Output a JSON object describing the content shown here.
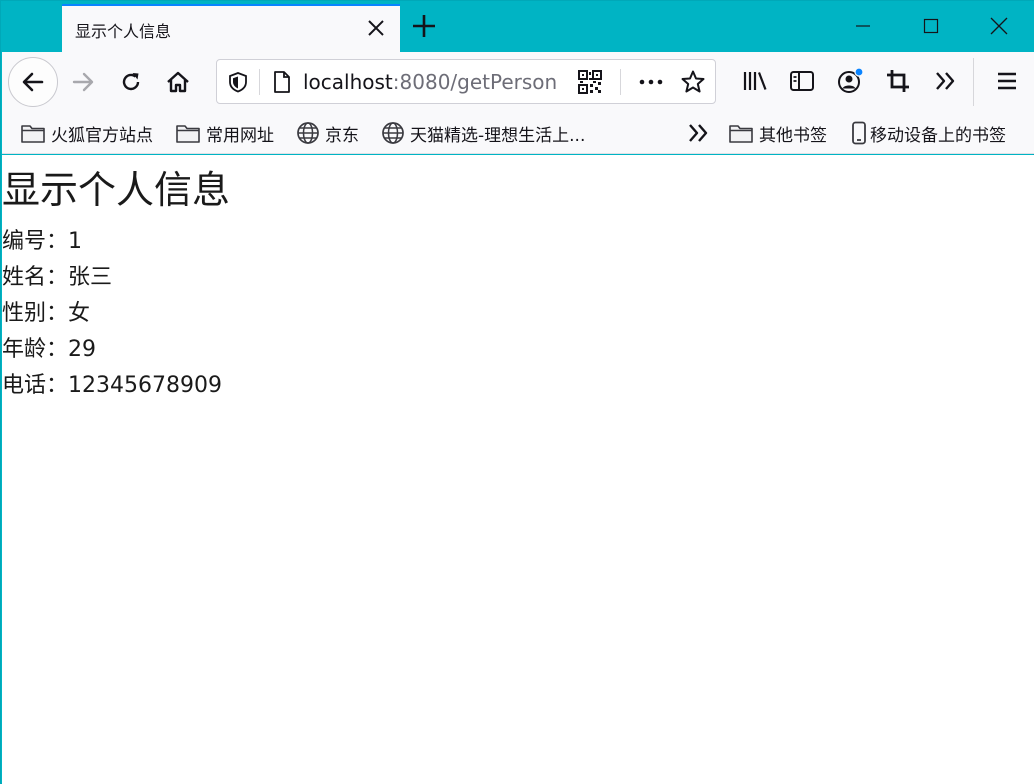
{
  "tab": {
    "title": "显示个人信息"
  },
  "urlbar": {
    "host": "localhost",
    "rest": ":8080/getPerson"
  },
  "bookmarks": [
    {
      "label": "火狐官方站点",
      "icon": "folder-icon"
    },
    {
      "label": "常用网址",
      "icon": "folder-icon"
    },
    {
      "label": "京东",
      "icon": "globe-icon"
    },
    {
      "label": "天猫精选-理想生活上...",
      "icon": "globe-icon"
    },
    {
      "label": "其他书签",
      "icon": "folder-icon"
    },
    {
      "label": "移动设备上的书签",
      "icon": "mobile-icon"
    }
  ],
  "page": {
    "title": "显示个人信息",
    "fields": [
      {
        "label": "编号：",
        "value": "1"
      },
      {
        "label": "姓名：",
        "value": "张三"
      },
      {
        "label": "性别：",
        "value": "女"
      },
      {
        "label": "年龄：",
        "value": "29"
      },
      {
        "label": "电话：",
        "value": "12345678909"
      }
    ]
  },
  "colors": {
    "titlebar": "#00b4c4",
    "toolbar": "#f9f9fb",
    "accent": "#0a84ff"
  }
}
